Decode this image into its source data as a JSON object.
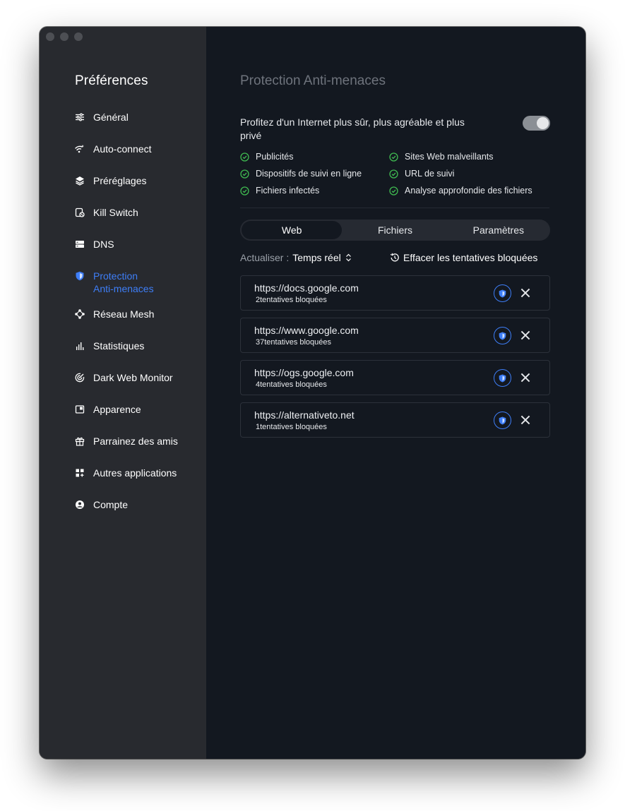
{
  "sidebar": {
    "title": "Préférences",
    "items": [
      {
        "label": "Général",
        "icon": "sliders-icon"
      },
      {
        "label": "Auto-connect",
        "icon": "wifi-icon"
      },
      {
        "label": "Préréglages",
        "icon": "layers-icon"
      },
      {
        "label": "Kill Switch",
        "icon": "kill-switch-icon"
      },
      {
        "label": "DNS",
        "icon": "server-icon"
      },
      {
        "label": "Protection\nAnti-menaces",
        "icon": "shield-icon",
        "active": true
      },
      {
        "label": "Réseau Mesh",
        "icon": "mesh-icon"
      },
      {
        "label": "Statistiques",
        "icon": "stats-icon"
      },
      {
        "label": "Dark Web Monitor",
        "icon": "radar-icon"
      },
      {
        "label": "Apparence",
        "icon": "appearance-icon"
      },
      {
        "label": "Parrainez des amis",
        "icon": "gift-icon"
      },
      {
        "label": "Autres applications",
        "icon": "apps-icon"
      },
      {
        "label": "Compte",
        "icon": "account-icon"
      }
    ]
  },
  "main": {
    "title": "Protection Anti-menaces",
    "intro": "Profitez d'un Internet plus sûr, plus agréable et plus privé",
    "toggle_on": true,
    "features": [
      "Publicités",
      "Sites Web malveillants",
      "Dispositifs de suivi en ligne",
      "URL de suivi",
      "Fichiers infectés",
      "Analyse approfondie des fichiers"
    ],
    "tabs": [
      {
        "label": "Web",
        "active": true
      },
      {
        "label": "Fichiers"
      },
      {
        "label": "Paramètres"
      }
    ],
    "refresh_label": "Actualiser :",
    "refresh_value": "Temps réel",
    "clear_label": "Effacer les tentatives bloquées",
    "blocked": [
      {
        "url": "https://docs.google.com",
        "count": "2tentatives bloquées"
      },
      {
        "url": "https://www.google.com",
        "count": "37tentatives bloquées"
      },
      {
        "url": "https://ogs.google.com",
        "count": "4tentatives bloquées"
      },
      {
        "url": "https://alternativeto.net",
        "count": "1tentatives bloquées"
      }
    ]
  },
  "colors": {
    "accent": "#3e7ef7",
    "check": "#3fb950",
    "sidebar_bg": "#282a2f",
    "main_bg": "#131820"
  }
}
